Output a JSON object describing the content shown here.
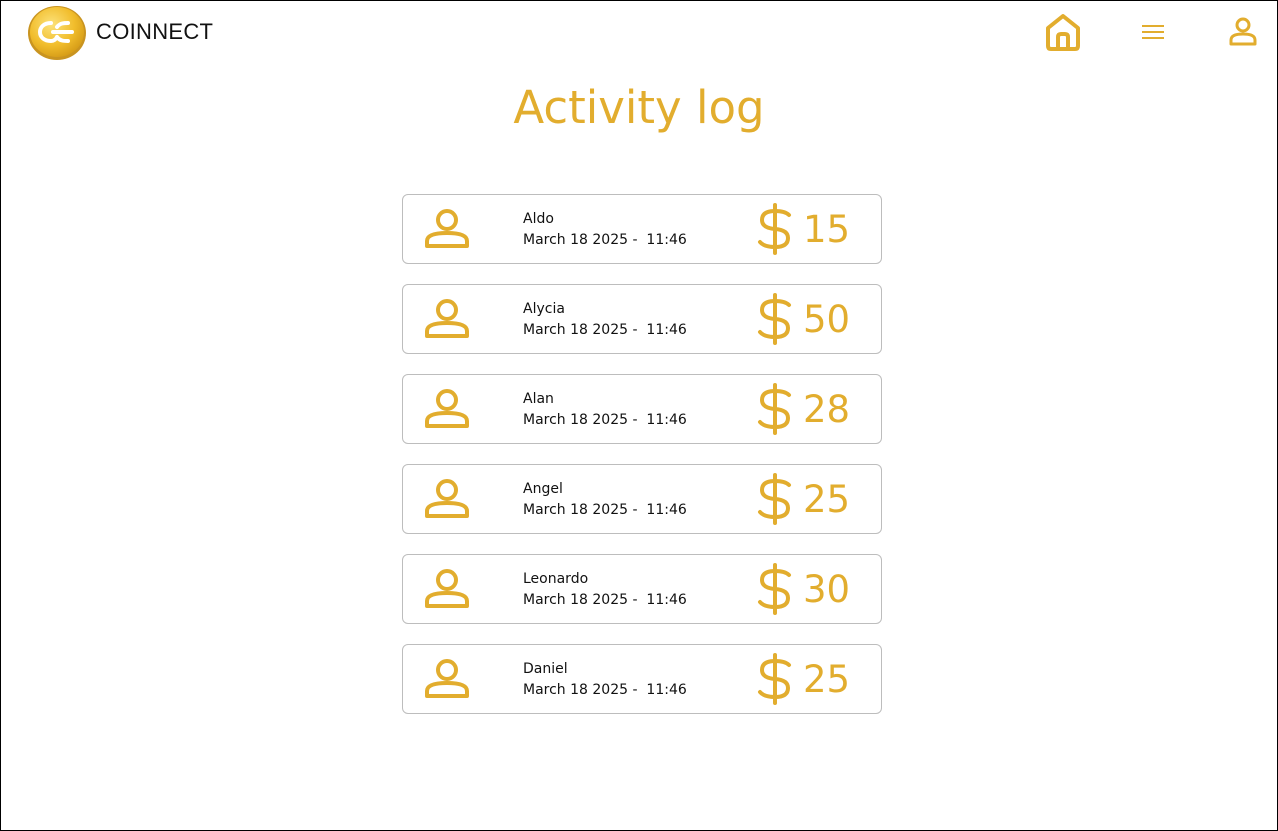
{
  "header": {
    "brand": "COINNECT",
    "logo_icon": "coinnect-coin-logo",
    "nav_icons": [
      "home-icon",
      "menu-icon",
      "user-icon"
    ]
  },
  "page": {
    "title": "Activity log"
  },
  "activity": [
    {
      "name": "Aldo",
      "date": "March 18 2025 -  11:46",
      "amount": "15"
    },
    {
      "name": "Alycia",
      "date": "March 18 2025 -  11:46",
      "amount": "50"
    },
    {
      "name": "Alan",
      "date": "March 18 2025 -  11:46",
      "amount": "28"
    },
    {
      "name": "Angel",
      "date": "March 18 2025 -  11:46",
      "amount": "25"
    },
    {
      "name": "Leonardo",
      "date": "March 18 2025 -  11:46",
      "amount": "30"
    },
    {
      "name": "Daniel",
      "date": "March 18 2025 -  11:46",
      "amount": "25"
    }
  ],
  "colors": {
    "accent": "#e2ad2e",
    "text": "#111111",
    "card_border": "#bdbdbd"
  }
}
